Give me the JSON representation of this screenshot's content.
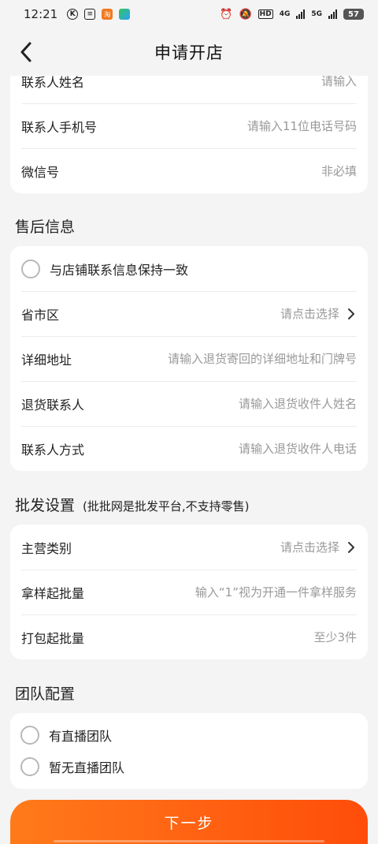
{
  "status_bar": {
    "time": "12:21",
    "network_labels": [
      "HD",
      "4G",
      "5G"
    ],
    "battery": "57"
  },
  "nav": {
    "title": "申请开店"
  },
  "contact_card": {
    "rows": [
      {
        "label": "联系人姓名",
        "placeholder": "请输入"
      },
      {
        "label": "联系人手机号",
        "placeholder": "请输入11位电话号码"
      },
      {
        "label": "微信号",
        "placeholder": "非必填"
      }
    ]
  },
  "after_sales": {
    "title": "售后信息",
    "same_as_store_label": "与店铺联系信息保持一致",
    "rows": [
      {
        "label": "省市区",
        "placeholder": "请点击选择"
      },
      {
        "label": "详细地址",
        "placeholder": "请输入退货寄回的详细地址和门牌号"
      },
      {
        "label": "退货联系人",
        "placeholder": "请输入退货收件人姓名"
      },
      {
        "label": "联系人方式",
        "placeholder": "请输入退货收件人电话"
      }
    ]
  },
  "wholesale": {
    "title": "批发设置",
    "note": "(批批网是批发平台,不支持零售)",
    "rows": [
      {
        "label": "主营类别",
        "placeholder": "请点击选择"
      },
      {
        "label": "拿样起批量",
        "placeholder": "输入“1”视为开通一件拿样服务"
      },
      {
        "label": "打包起批量",
        "placeholder": "至少3件"
      }
    ]
  },
  "team": {
    "title": "团队配置",
    "options": [
      "有直播团队",
      "暂无直播团队"
    ]
  },
  "next_button": "下一步",
  "colors": {
    "accent_start": "#ff7a1a",
    "accent_end": "#ff4d0a",
    "background": "#f4f4f4",
    "placeholder": "#999999"
  }
}
